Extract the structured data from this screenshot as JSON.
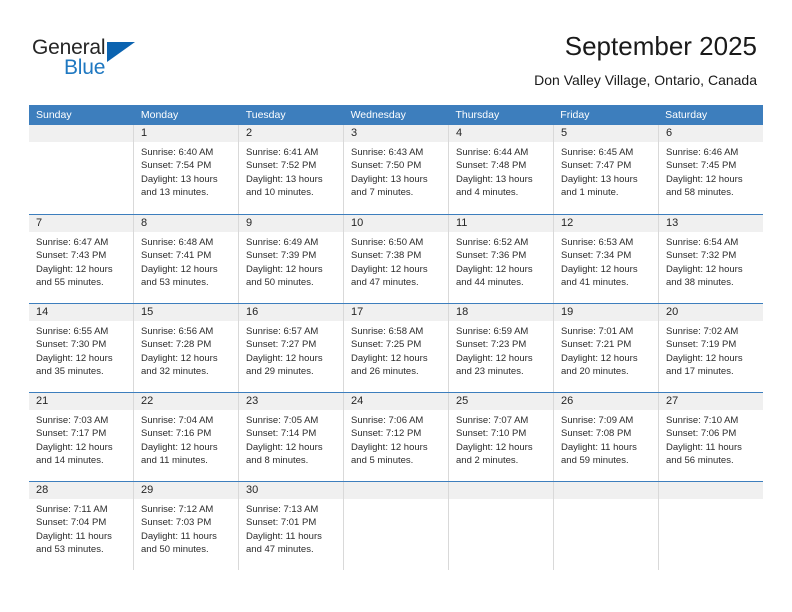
{
  "brand": {
    "name_part1": "General",
    "name_part2": "Blue",
    "accent_color": "#0b63b0",
    "blue_text_color": "#1f78c1"
  },
  "header": {
    "title": "September 2025",
    "location": "Don Valley Village, Ontario, Canada"
  },
  "theme": {
    "header_row_bg": "#3d7ebd",
    "day_band_bg": "#f0f0f0",
    "grid_line": "#d9d9d9",
    "week_separator": "#3d7ebd"
  },
  "weekdays": [
    "Sunday",
    "Monday",
    "Tuesday",
    "Wednesday",
    "Thursday",
    "Friday",
    "Saturday"
  ],
  "weeks": [
    {
      "days": [
        {
          "num": "",
          "sunrise": "",
          "sunset": "",
          "daylight_line1": "",
          "daylight_line2": "",
          "empty": true
        },
        {
          "num": "1",
          "sunrise": "Sunrise: 6:40 AM",
          "sunset": "Sunset: 7:54 PM",
          "daylight_line1": "Daylight: 13 hours",
          "daylight_line2": "and 13 minutes."
        },
        {
          "num": "2",
          "sunrise": "Sunrise: 6:41 AM",
          "sunset": "Sunset: 7:52 PM",
          "daylight_line1": "Daylight: 13 hours",
          "daylight_line2": "and 10 minutes."
        },
        {
          "num": "3",
          "sunrise": "Sunrise: 6:43 AM",
          "sunset": "Sunset: 7:50 PM",
          "daylight_line1": "Daylight: 13 hours",
          "daylight_line2": "and 7 minutes."
        },
        {
          "num": "4",
          "sunrise": "Sunrise: 6:44 AM",
          "sunset": "Sunset: 7:48 PM",
          "daylight_line1": "Daylight: 13 hours",
          "daylight_line2": "and 4 minutes."
        },
        {
          "num": "5",
          "sunrise": "Sunrise: 6:45 AM",
          "sunset": "Sunset: 7:47 PM",
          "daylight_line1": "Daylight: 13 hours",
          "daylight_line2": "and 1 minute."
        },
        {
          "num": "6",
          "sunrise": "Sunrise: 6:46 AM",
          "sunset": "Sunset: 7:45 PM",
          "daylight_line1": "Daylight: 12 hours",
          "daylight_line2": "and 58 minutes."
        }
      ]
    },
    {
      "days": [
        {
          "num": "7",
          "sunrise": "Sunrise: 6:47 AM",
          "sunset": "Sunset: 7:43 PM",
          "daylight_line1": "Daylight: 12 hours",
          "daylight_line2": "and 55 minutes."
        },
        {
          "num": "8",
          "sunrise": "Sunrise: 6:48 AM",
          "sunset": "Sunset: 7:41 PM",
          "daylight_line1": "Daylight: 12 hours",
          "daylight_line2": "and 53 minutes."
        },
        {
          "num": "9",
          "sunrise": "Sunrise: 6:49 AM",
          "sunset": "Sunset: 7:39 PM",
          "daylight_line1": "Daylight: 12 hours",
          "daylight_line2": "and 50 minutes."
        },
        {
          "num": "10",
          "sunrise": "Sunrise: 6:50 AM",
          "sunset": "Sunset: 7:38 PM",
          "daylight_line1": "Daylight: 12 hours",
          "daylight_line2": "and 47 minutes."
        },
        {
          "num": "11",
          "sunrise": "Sunrise: 6:52 AM",
          "sunset": "Sunset: 7:36 PM",
          "daylight_line1": "Daylight: 12 hours",
          "daylight_line2": "and 44 minutes."
        },
        {
          "num": "12",
          "sunrise": "Sunrise: 6:53 AM",
          "sunset": "Sunset: 7:34 PM",
          "daylight_line1": "Daylight: 12 hours",
          "daylight_line2": "and 41 minutes."
        },
        {
          "num": "13",
          "sunrise": "Sunrise: 6:54 AM",
          "sunset": "Sunset: 7:32 PM",
          "daylight_line1": "Daylight: 12 hours",
          "daylight_line2": "and 38 minutes."
        }
      ]
    },
    {
      "days": [
        {
          "num": "14",
          "sunrise": "Sunrise: 6:55 AM",
          "sunset": "Sunset: 7:30 PM",
          "daylight_line1": "Daylight: 12 hours",
          "daylight_line2": "and 35 minutes."
        },
        {
          "num": "15",
          "sunrise": "Sunrise: 6:56 AM",
          "sunset": "Sunset: 7:28 PM",
          "daylight_line1": "Daylight: 12 hours",
          "daylight_line2": "and 32 minutes."
        },
        {
          "num": "16",
          "sunrise": "Sunrise: 6:57 AM",
          "sunset": "Sunset: 7:27 PM",
          "daylight_line1": "Daylight: 12 hours",
          "daylight_line2": "and 29 minutes."
        },
        {
          "num": "17",
          "sunrise": "Sunrise: 6:58 AM",
          "sunset": "Sunset: 7:25 PM",
          "daylight_line1": "Daylight: 12 hours",
          "daylight_line2": "and 26 minutes."
        },
        {
          "num": "18",
          "sunrise": "Sunrise: 6:59 AM",
          "sunset": "Sunset: 7:23 PM",
          "daylight_line1": "Daylight: 12 hours",
          "daylight_line2": "and 23 minutes."
        },
        {
          "num": "19",
          "sunrise": "Sunrise: 7:01 AM",
          "sunset": "Sunset: 7:21 PM",
          "daylight_line1": "Daylight: 12 hours",
          "daylight_line2": "and 20 minutes."
        },
        {
          "num": "20",
          "sunrise": "Sunrise: 7:02 AM",
          "sunset": "Sunset: 7:19 PM",
          "daylight_line1": "Daylight: 12 hours",
          "daylight_line2": "and 17 minutes."
        }
      ]
    },
    {
      "days": [
        {
          "num": "21",
          "sunrise": "Sunrise: 7:03 AM",
          "sunset": "Sunset: 7:17 PM",
          "daylight_line1": "Daylight: 12 hours",
          "daylight_line2": "and 14 minutes."
        },
        {
          "num": "22",
          "sunrise": "Sunrise: 7:04 AM",
          "sunset": "Sunset: 7:16 PM",
          "daylight_line1": "Daylight: 12 hours",
          "daylight_line2": "and 11 minutes."
        },
        {
          "num": "23",
          "sunrise": "Sunrise: 7:05 AM",
          "sunset": "Sunset: 7:14 PM",
          "daylight_line1": "Daylight: 12 hours",
          "daylight_line2": "and 8 minutes."
        },
        {
          "num": "24",
          "sunrise": "Sunrise: 7:06 AM",
          "sunset": "Sunset: 7:12 PM",
          "daylight_line1": "Daylight: 12 hours",
          "daylight_line2": "and 5 minutes."
        },
        {
          "num": "25",
          "sunrise": "Sunrise: 7:07 AM",
          "sunset": "Sunset: 7:10 PM",
          "daylight_line1": "Daylight: 12 hours",
          "daylight_line2": "and 2 minutes."
        },
        {
          "num": "26",
          "sunrise": "Sunrise: 7:09 AM",
          "sunset": "Sunset: 7:08 PM",
          "daylight_line1": "Daylight: 11 hours",
          "daylight_line2": "and 59 minutes."
        },
        {
          "num": "27",
          "sunrise": "Sunrise: 7:10 AM",
          "sunset": "Sunset: 7:06 PM",
          "daylight_line1": "Daylight: 11 hours",
          "daylight_line2": "and 56 minutes."
        }
      ]
    },
    {
      "days": [
        {
          "num": "28",
          "sunrise": "Sunrise: 7:11 AM",
          "sunset": "Sunset: 7:04 PM",
          "daylight_line1": "Daylight: 11 hours",
          "daylight_line2": "and 53 minutes."
        },
        {
          "num": "29",
          "sunrise": "Sunrise: 7:12 AM",
          "sunset": "Sunset: 7:03 PM",
          "daylight_line1": "Daylight: 11 hours",
          "daylight_line2": "and 50 minutes."
        },
        {
          "num": "30",
          "sunrise": "Sunrise: 7:13 AM",
          "sunset": "Sunset: 7:01 PM",
          "daylight_line1": "Daylight: 11 hours",
          "daylight_line2": "and 47 minutes."
        },
        {
          "num": "",
          "sunrise": "",
          "sunset": "",
          "daylight_line1": "",
          "daylight_line2": "",
          "empty": true
        },
        {
          "num": "",
          "sunrise": "",
          "sunset": "",
          "daylight_line1": "",
          "daylight_line2": "",
          "empty": true
        },
        {
          "num": "",
          "sunrise": "",
          "sunset": "",
          "daylight_line1": "",
          "daylight_line2": "",
          "empty": true
        },
        {
          "num": "",
          "sunrise": "",
          "sunset": "",
          "daylight_line1": "",
          "daylight_line2": "",
          "empty": true
        }
      ]
    }
  ]
}
